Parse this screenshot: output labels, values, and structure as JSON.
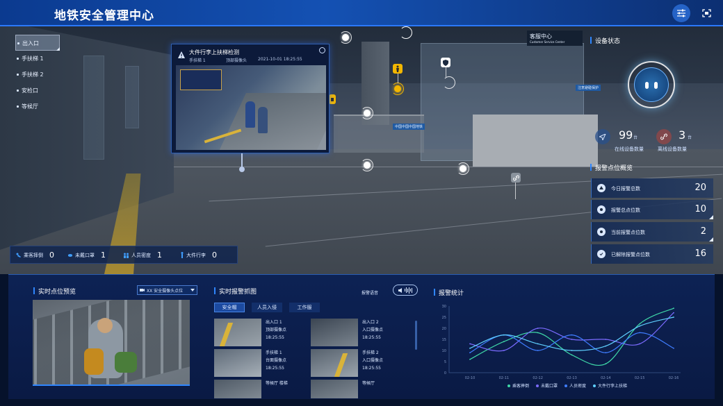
{
  "header": {
    "title": "地铁安全管理中心"
  },
  "nav": {
    "items": [
      {
        "label": "出入口",
        "active": true
      },
      {
        "label": "手扶梯 1",
        "active": false
      },
      {
        "label": "手扶梯 2",
        "active": false
      },
      {
        "label": "安检口",
        "active": false
      },
      {
        "label": "等候厅",
        "active": false
      }
    ]
  },
  "scene_signs": {
    "service_center": "客服中心",
    "service_center_en": "Customer Service Center",
    "exit_sign": "中国中国中国地铁",
    "notice": "注意避碰保护"
  },
  "popup": {
    "title": "大件行李上扶梯检测",
    "location": "手扶梯 1",
    "camera": "顶部摄像头",
    "time": "2021-10-01 18:25:55"
  },
  "event_bar": [
    {
      "label": "乘客摔倒",
      "value": "0",
      "icon": "person-fall-icon"
    },
    {
      "label": "未戴口罩",
      "value": "1",
      "icon": "mask-icon"
    },
    {
      "label": "人员密度",
      "value": "1",
      "icon": "crowd-icon"
    },
    {
      "label": "大件行李",
      "value": "0",
      "icon": "luggage-icon"
    }
  ],
  "device_status": {
    "title": "设备状态",
    "online": {
      "value": "99",
      "unit": "台",
      "label": "在线设备数量"
    },
    "offline": {
      "value": "3",
      "unit": "台",
      "label": "离线设备数量"
    }
  },
  "alarm_overview": {
    "title": "报警点位概览",
    "rows": [
      {
        "label": "今日报警总数",
        "value": "20"
      },
      {
        "label": "报警总点位数",
        "value": "10"
      },
      {
        "label": "当前报警点位数",
        "value": "2"
      },
      {
        "label": "已解除报警点位数",
        "value": "16"
      }
    ]
  },
  "live_preview": {
    "title": "实时点位预览",
    "camera_select": "XX 安全摄像头点位"
  },
  "alarm_capture": {
    "title": "实时报警抓图",
    "voice_label": "报警语音",
    "tabs": [
      "安全帽",
      "人员入侵",
      "工作服"
    ],
    "active_tab": 0,
    "items": [
      {
        "location": "出入口 1",
        "camera": "顶部摄像点",
        "time": "18:25:55"
      },
      {
        "location": "出入口 2",
        "camera": "入口摄像点",
        "time": "18:25:55"
      },
      {
        "location": "手扶梯 1",
        "camera": "台面摄像点",
        "time": "18:25:55"
      },
      {
        "location": "手扶梯 2",
        "camera": "入口摄像点",
        "time": "18:25:55"
      },
      {
        "location": "等候厅 楼梯",
        "camera": "",
        "time": ""
      },
      {
        "location": "等候厅",
        "camera": "",
        "time": ""
      }
    ]
  },
  "chart_data": {
    "type": "line",
    "title": "报警统计",
    "x": [
      "02-10",
      "02-11",
      "02-12",
      "02-13",
      "02-14",
      "02-15",
      "02-16"
    ],
    "ylim": [
      0,
      30
    ],
    "yticks": [
      0,
      5,
      10,
      15,
      20,
      25,
      30
    ],
    "grid": false,
    "legend_position": "bottom",
    "series": [
      {
        "name": "乘客摔倒",
        "color": "#3fd8a8",
        "values": [
          6,
          14,
          18,
          8,
          4,
          22,
          29
        ]
      },
      {
        "name": "未戴口罩",
        "color": "#7b6bff",
        "values": [
          13,
          10,
          20,
          15,
          15,
          13,
          27
        ]
      },
      {
        "name": "人员密度",
        "color": "#3f7dff",
        "values": [
          9,
          17,
          10,
          17,
          9,
          18,
          11
        ]
      },
      {
        "name": "大件行李上扶梯",
        "color": "#5fd0ff",
        "values": [
          11,
          17,
          13,
          10,
          12,
          21,
          25
        ]
      }
    ]
  }
}
